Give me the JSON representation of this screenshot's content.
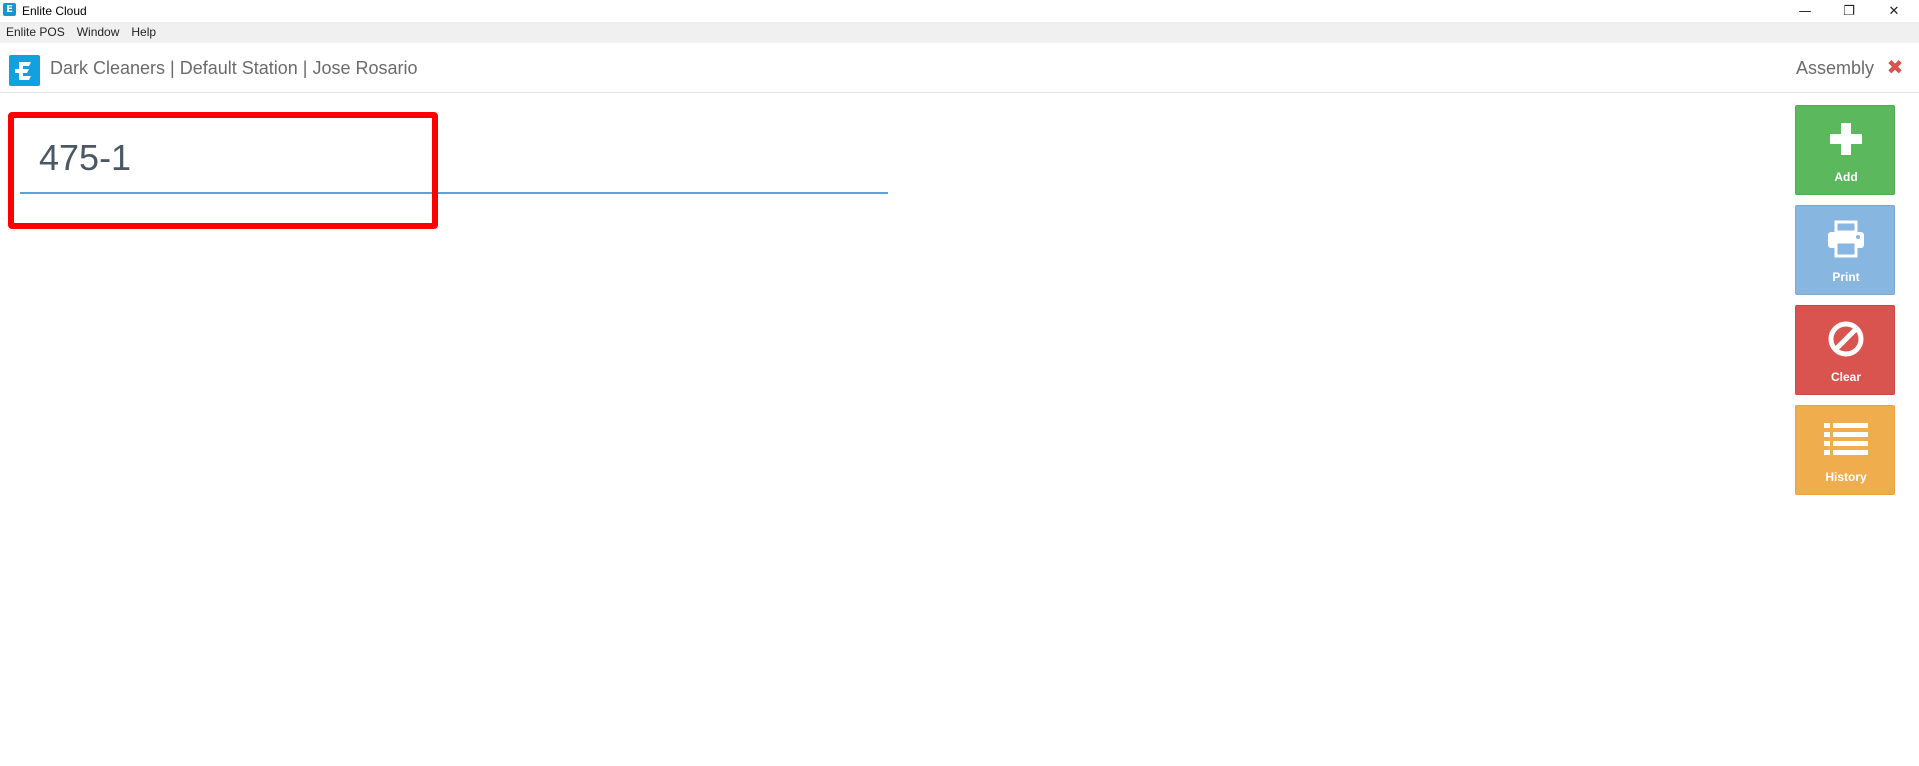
{
  "window": {
    "title": "Enlite Cloud",
    "icon": "enlite-e-icon",
    "controls": {
      "minimize": "—",
      "restore": "❐",
      "close": "✕"
    }
  },
  "menubar": {
    "items": [
      {
        "label": "Enlite POS"
      },
      {
        "label": "Window"
      },
      {
        "label": "Help"
      }
    ]
  },
  "header": {
    "context": "Dark Cleaners | Default Station | Jose Rosario",
    "screen_title": "Assembly",
    "close_icon": "close-x-icon",
    "close_glyph": "✖"
  },
  "ticket": {
    "value": "475-1"
  },
  "actions": [
    {
      "label": "Add",
      "icon": "plus-icon",
      "color": "#5cb85c"
    },
    {
      "label": "Print",
      "icon": "printer-icon",
      "color": "#87b6e0"
    },
    {
      "label": "Clear",
      "icon": "ban-icon",
      "color": "#d9534f"
    },
    {
      "label": "History",
      "icon": "list-icon",
      "color": "#f0ad4e"
    }
  ],
  "colors": {
    "brand": "#12a1e0",
    "input_underline": "#5aa3d4",
    "highlight": "#ff0000"
  }
}
